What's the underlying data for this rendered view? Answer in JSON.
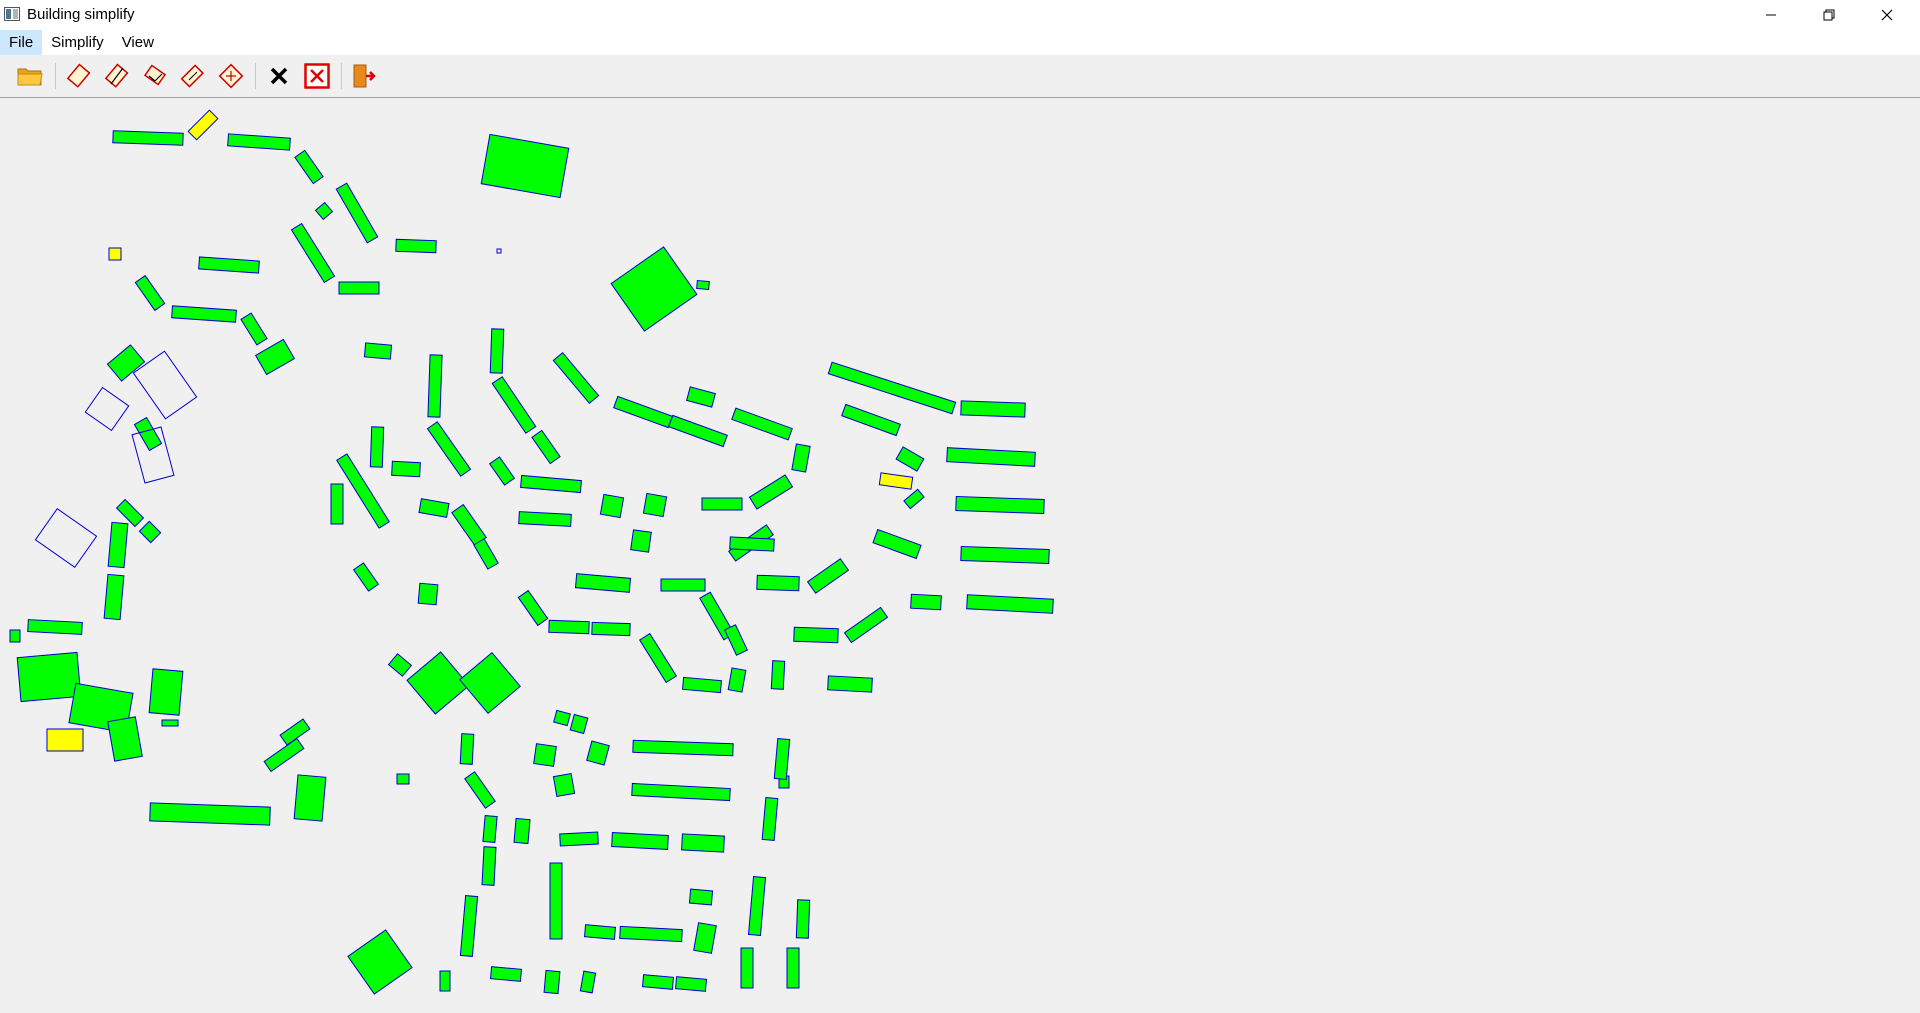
{
  "window": {
    "title": "Building simplify"
  },
  "menu": {
    "file": "File",
    "simplify": "Simplify",
    "view": "View"
  },
  "toolbar": {
    "tools": [
      "open-folder-icon",
      "simplify-1-icon",
      "simplify-2-icon",
      "simplify-3-icon",
      "simplify-4-icon",
      "simplify-5-icon",
      "clear-icon",
      "clear-all-icon",
      "exit-icon"
    ]
  },
  "colors": {
    "building_fill": "#00ff00",
    "outline": "#0000cc",
    "highlight": "#ffff00",
    "background": "#f0f0f0"
  }
}
